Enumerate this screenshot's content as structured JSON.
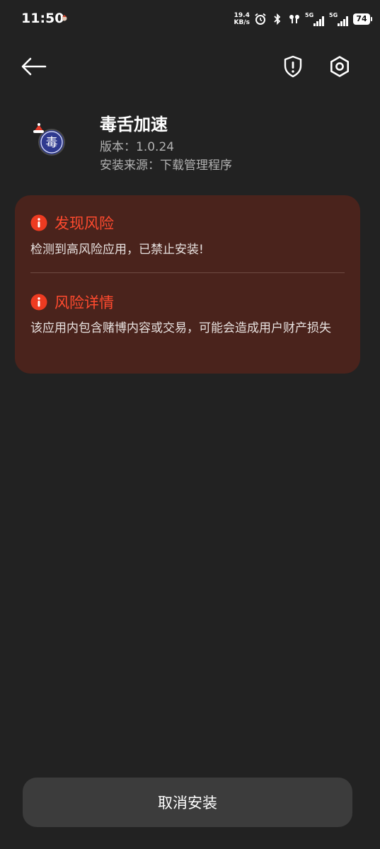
{
  "status_bar": {
    "time": "11:50",
    "net_speed_value": "19.4",
    "net_speed_unit": "KB/s",
    "signal1_label": "5G",
    "signal2_label": "5G",
    "battery": "74"
  },
  "app": {
    "name": "毒舌加速",
    "version_line": "版本：1.0.24",
    "source_line": "安装来源：下载管理程序",
    "icon_glyph": "毒"
  },
  "risk_card": {
    "section1_title": "发现风险",
    "section1_text": "检测到高风险应用，已禁止安装!",
    "section2_title": "风险详情",
    "section2_text": "该应用内包含赌博内容或交易，可能会造成用户财产损失"
  },
  "actions": {
    "cancel_label": "取消安装"
  },
  "colors": {
    "background": "#222222",
    "card": "#4a231c",
    "danger": "#ff4a2e",
    "button": "#3c3c3c"
  }
}
